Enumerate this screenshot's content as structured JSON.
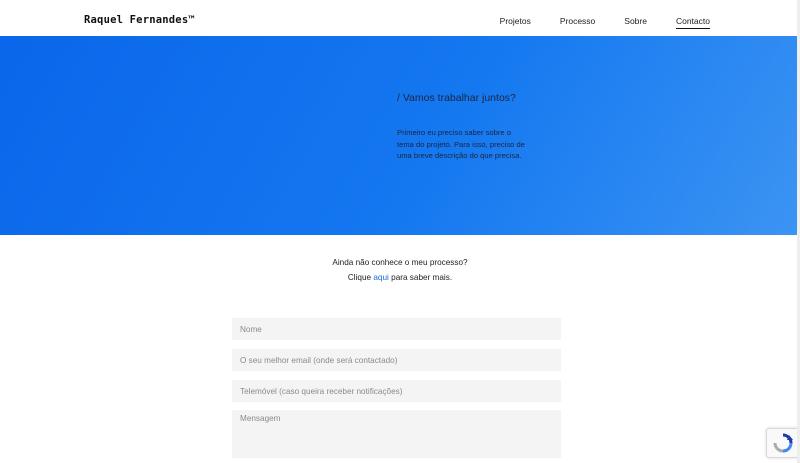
{
  "header": {
    "logo": "Raquel Fernandes™",
    "nav": [
      {
        "label": "Projetos"
      },
      {
        "label": "Processo"
      },
      {
        "label": "Sobre"
      },
      {
        "label": "Contacto",
        "active": true
      }
    ]
  },
  "hero": {
    "title": "/ Vamos trabalhar juntos?",
    "text": "Primeiro eu preciso saber sobre o tema do projeto. Para isso, preciso de uma breve descrição do que precisa."
  },
  "process": {
    "line1": "Ainda não conhece o meu processo?",
    "prefix": "Clique",
    "link": "aqui",
    "suffix": "para saber mais."
  },
  "form": {
    "name_placeholder": "Nome",
    "email_placeholder": "O seu melhor email (onde será contactado)",
    "phone_placeholder": "Telemóvel (caso queira receber notificações)",
    "message_placeholder": "Mensagem"
  },
  "colors": {
    "hero_start": "#0a66ea",
    "hero_end": "#3c94f3",
    "link": "#1a6cd8"
  },
  "icons": {
    "recaptcha": "recaptcha-icon"
  }
}
